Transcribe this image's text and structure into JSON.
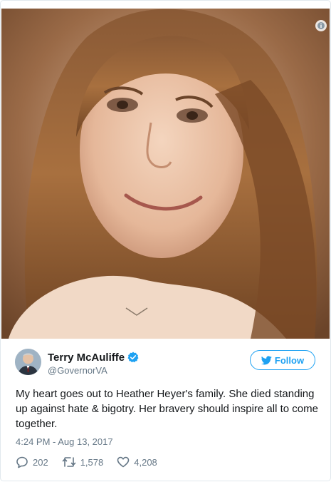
{
  "tweet": {
    "author_name": "Terry McAuliffe",
    "handle": "@GovernorVA",
    "verified": true,
    "follow_label": "Follow",
    "text": "My heart goes out to Heather Heyer's family. She died standing up against hate & bigotry. Her bravery should inspire all to come together.",
    "timestamp": "4:24 PM - Aug 13, 2017",
    "replies": "202",
    "retweets": "1,578",
    "likes": "4,208"
  },
  "icons": {
    "info": "info-icon",
    "verified": "verified-badge-icon",
    "bird": "twitter-bird-icon",
    "reply": "reply-icon",
    "retweet": "retweet-icon",
    "like": "heart-icon"
  },
  "colors": {
    "accent": "#1da1f2",
    "text": "#14171a",
    "muted": "#657786",
    "border": "#e1e8ed"
  }
}
